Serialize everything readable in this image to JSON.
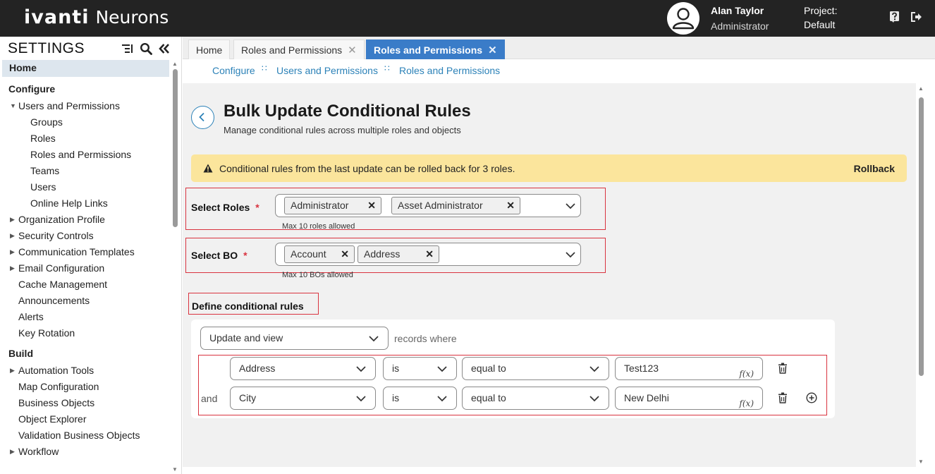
{
  "header": {
    "logo_main": "ivanti",
    "logo_sub": "Neurons",
    "user_name": "Alan Taylor",
    "user_role": "Administrator",
    "project_label": "Project:",
    "project_value": "Default"
  },
  "sidebar": {
    "title": "SETTINGS",
    "items": [
      {
        "label": "Home",
        "kind": "home"
      },
      {
        "label": "Configure",
        "kind": "section"
      },
      {
        "label": "Users and Permissions",
        "kind": "l1",
        "expander": "open"
      },
      {
        "label": "Groups",
        "kind": "l2"
      },
      {
        "label": "Roles",
        "kind": "l2"
      },
      {
        "label": "Roles and Permissions",
        "kind": "l2"
      },
      {
        "label": "Teams",
        "kind": "l2"
      },
      {
        "label": "Users",
        "kind": "l2"
      },
      {
        "label": "Online Help Links",
        "kind": "l2"
      },
      {
        "label": "Organization Profile",
        "kind": "l1",
        "expander": "closed"
      },
      {
        "label": "Security Controls",
        "kind": "l1",
        "expander": "closed"
      },
      {
        "label": "Communication Templates",
        "kind": "l1",
        "expander": "closed"
      },
      {
        "label": "Email Configuration",
        "kind": "l1",
        "expander": "closed"
      },
      {
        "label": "Cache Management",
        "kind": "l1"
      },
      {
        "label": "Announcements",
        "kind": "l1"
      },
      {
        "label": "Alerts",
        "kind": "l1"
      },
      {
        "label": "Key Rotation",
        "kind": "l1"
      },
      {
        "label": "Build",
        "kind": "section"
      },
      {
        "label": "Automation Tools",
        "kind": "l1",
        "expander": "closed"
      },
      {
        "label": "Map Configuration",
        "kind": "l1"
      },
      {
        "label": "Business Objects",
        "kind": "l1"
      },
      {
        "label": "Object Explorer",
        "kind": "l1"
      },
      {
        "label": "Validation Business Objects",
        "kind": "l1"
      },
      {
        "label": "Workflow",
        "kind": "l1",
        "expander": "closed"
      }
    ]
  },
  "tabs": [
    {
      "label": "Home"
    },
    {
      "label": "Roles and Permissions",
      "close": "✕"
    },
    {
      "label": "Roles and Permissions",
      "close": "✕",
      "active": true
    }
  ],
  "breadcrumb": [
    "Configure",
    "Users and Permissions",
    "Roles and Permissions"
  ],
  "page": {
    "title": "Bulk Update Conditional Rules",
    "subtitle": "Manage conditional rules across multiple roles and objects"
  },
  "banner": {
    "text": "Conditional rules from the last update can be rolled back for 3 roles.",
    "action": "Rollback"
  },
  "select_roles": {
    "label": "Select Roles",
    "required": "*",
    "chips": [
      "Administrator",
      "Asset Administrator"
    ],
    "hint": "Max 10 roles allowed"
  },
  "select_bo": {
    "label": "Select BO",
    "required": "*",
    "chips": [
      "Account",
      "Address"
    ],
    "hint": "Max 10 BOs allowed"
  },
  "rules": {
    "title": "Define conditional rules",
    "mode": "Update and view",
    "records_where": "records where",
    "and_label": "and",
    "fx_label": "f(x)",
    "rows": [
      {
        "field": "Address",
        "op": "is",
        "cmp": "equal to",
        "value": "Test123"
      },
      {
        "field": "City",
        "op": "is",
        "cmp": "equal to",
        "value": "New Delhi"
      }
    ]
  },
  "colors": {
    "topbar": "#232323",
    "active_tab": "#3a7cc8",
    "link": "#2c82b8",
    "banner": "#fbe59c",
    "highlight_box": "#d9333f"
  }
}
